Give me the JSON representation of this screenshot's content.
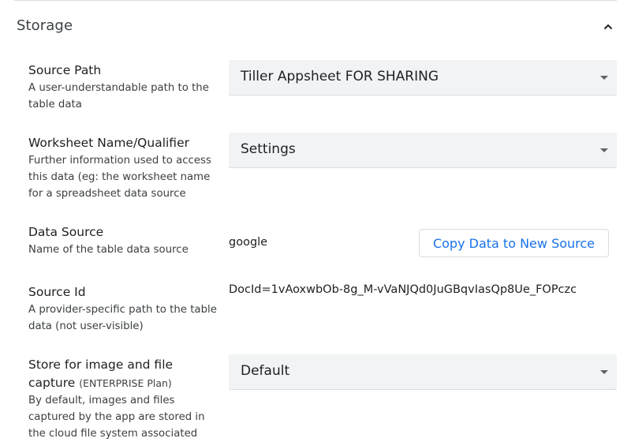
{
  "section": {
    "title": "Storage"
  },
  "source_path": {
    "label": "Source Path",
    "desc": "A user-understandable path to the table data",
    "value": "Tiller Appsheet FOR SHARING"
  },
  "worksheet": {
    "label": "Worksheet Name/Qualifier",
    "desc": "Further information used to access this data (eg: the worksheet name for a spreadsheet data source",
    "value": "Settings"
  },
  "data_source": {
    "label": "Data Source",
    "desc": "Name of the table data source",
    "value": "google",
    "button": "Copy Data to New Source"
  },
  "source_id": {
    "label": "Source Id",
    "desc": "A provider-specific path to the table data (not user-visible)",
    "value": "DocId=1vAoxwbOb-8g_M-vVaNJQd0JuGBqvIasQp8Ue_FOPczc"
  },
  "store_image": {
    "label": "Store for image and file capture",
    "plan": "(ENTERPRISE Plan)",
    "desc": "By default, images and files captured by the app are stored in the cloud file system associated",
    "value": "Default"
  },
  "colors": {
    "accent": "#1a73e8",
    "field_bg": "#f1f3f4"
  },
  "icons": {
    "collapse": "chevron-up-icon",
    "dropdown": "caret-down-icon"
  }
}
